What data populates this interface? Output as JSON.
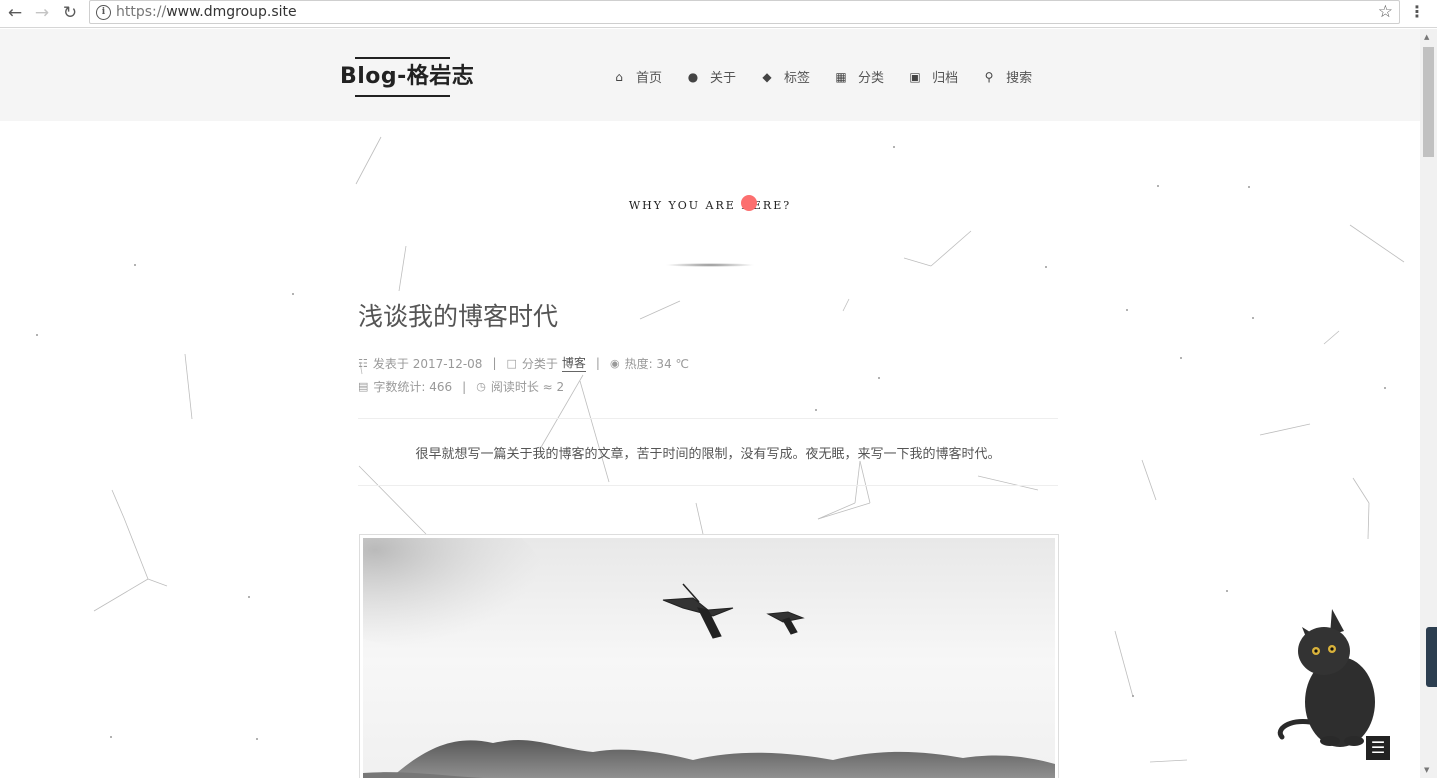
{
  "browser": {
    "url_scheme": "https://",
    "url_host": "www.dmgroup.site",
    "back_icon": "arrow-left-icon",
    "forward_icon": "arrow-right-icon",
    "reload_icon": "reload-icon",
    "info_icon": "info-icon",
    "bookmark_icon": "star-icon",
    "menu_icon": "kebab-menu-icon"
  },
  "header": {
    "brand": "Blog-格岩志",
    "menu": [
      {
        "label": "首页",
        "icon": "home-icon"
      },
      {
        "label": "关于",
        "icon": "user-icon"
      },
      {
        "label": "标签",
        "icon": "tags-icon"
      },
      {
        "label": "分类",
        "icon": "th-icon"
      },
      {
        "label": "归档",
        "icon": "archive-icon"
      },
      {
        "label": "搜索",
        "icon": "search-icon"
      }
    ]
  },
  "subtitle": "WHY YOU ARE HERE?",
  "post": {
    "title": "浅谈我的博客时代",
    "posted_label": "发表于 2017-12-08",
    "category_prefix": "分类于",
    "category": "博客",
    "views_label": "热度: 34 ℃",
    "wordcount_label": "字数统计: 466",
    "readtime_label": "阅读时长 ≈ 2",
    "excerpt": "很早就想写一篇关于我的博客的文章，苦于时间的限制，没有写成。夜无眠，来写一下我的博客时代。"
  },
  "colors": {
    "accent_dot": "#fc6f6f",
    "header_bg": "#f5f5f5",
    "text": "#555555"
  }
}
